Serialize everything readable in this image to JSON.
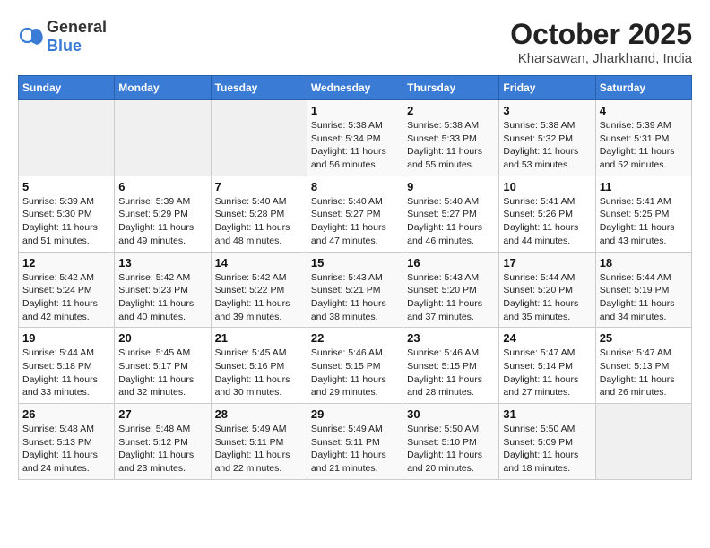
{
  "header": {
    "logo_general": "General",
    "logo_blue": "Blue",
    "month_year": "October 2025",
    "location": "Kharsawan, Jharkhand, India"
  },
  "days_of_week": [
    "Sunday",
    "Monday",
    "Tuesday",
    "Wednesday",
    "Thursday",
    "Friday",
    "Saturday"
  ],
  "weeks": [
    [
      {
        "day": "",
        "sunrise": "",
        "sunset": "",
        "daylight": "",
        "empty": true
      },
      {
        "day": "",
        "sunrise": "",
        "sunset": "",
        "daylight": "",
        "empty": true
      },
      {
        "day": "",
        "sunrise": "",
        "sunset": "",
        "daylight": "",
        "empty": true
      },
      {
        "day": "1",
        "sunrise": "Sunrise: 5:38 AM",
        "sunset": "Sunset: 5:34 PM",
        "daylight": "Daylight: 11 hours and 56 minutes."
      },
      {
        "day": "2",
        "sunrise": "Sunrise: 5:38 AM",
        "sunset": "Sunset: 5:33 PM",
        "daylight": "Daylight: 11 hours and 55 minutes."
      },
      {
        "day": "3",
        "sunrise": "Sunrise: 5:38 AM",
        "sunset": "Sunset: 5:32 PM",
        "daylight": "Daylight: 11 hours and 53 minutes."
      },
      {
        "day": "4",
        "sunrise": "Sunrise: 5:39 AM",
        "sunset": "Sunset: 5:31 PM",
        "daylight": "Daylight: 11 hours and 52 minutes."
      }
    ],
    [
      {
        "day": "5",
        "sunrise": "Sunrise: 5:39 AM",
        "sunset": "Sunset: 5:30 PM",
        "daylight": "Daylight: 11 hours and 51 minutes."
      },
      {
        "day": "6",
        "sunrise": "Sunrise: 5:39 AM",
        "sunset": "Sunset: 5:29 PM",
        "daylight": "Daylight: 11 hours and 49 minutes."
      },
      {
        "day": "7",
        "sunrise": "Sunrise: 5:40 AM",
        "sunset": "Sunset: 5:28 PM",
        "daylight": "Daylight: 11 hours and 48 minutes."
      },
      {
        "day": "8",
        "sunrise": "Sunrise: 5:40 AM",
        "sunset": "Sunset: 5:27 PM",
        "daylight": "Daylight: 11 hours and 47 minutes."
      },
      {
        "day": "9",
        "sunrise": "Sunrise: 5:40 AM",
        "sunset": "Sunset: 5:27 PM",
        "daylight": "Daylight: 11 hours and 46 minutes."
      },
      {
        "day": "10",
        "sunrise": "Sunrise: 5:41 AM",
        "sunset": "Sunset: 5:26 PM",
        "daylight": "Daylight: 11 hours and 44 minutes."
      },
      {
        "day": "11",
        "sunrise": "Sunrise: 5:41 AM",
        "sunset": "Sunset: 5:25 PM",
        "daylight": "Daylight: 11 hours and 43 minutes."
      }
    ],
    [
      {
        "day": "12",
        "sunrise": "Sunrise: 5:42 AM",
        "sunset": "Sunset: 5:24 PM",
        "daylight": "Daylight: 11 hours and 42 minutes."
      },
      {
        "day": "13",
        "sunrise": "Sunrise: 5:42 AM",
        "sunset": "Sunset: 5:23 PM",
        "daylight": "Daylight: 11 hours and 40 minutes."
      },
      {
        "day": "14",
        "sunrise": "Sunrise: 5:42 AM",
        "sunset": "Sunset: 5:22 PM",
        "daylight": "Daylight: 11 hours and 39 minutes."
      },
      {
        "day": "15",
        "sunrise": "Sunrise: 5:43 AM",
        "sunset": "Sunset: 5:21 PM",
        "daylight": "Daylight: 11 hours and 38 minutes."
      },
      {
        "day": "16",
        "sunrise": "Sunrise: 5:43 AM",
        "sunset": "Sunset: 5:20 PM",
        "daylight": "Daylight: 11 hours and 37 minutes."
      },
      {
        "day": "17",
        "sunrise": "Sunrise: 5:44 AM",
        "sunset": "Sunset: 5:20 PM",
        "daylight": "Daylight: 11 hours and 35 minutes."
      },
      {
        "day": "18",
        "sunrise": "Sunrise: 5:44 AM",
        "sunset": "Sunset: 5:19 PM",
        "daylight": "Daylight: 11 hours and 34 minutes."
      }
    ],
    [
      {
        "day": "19",
        "sunrise": "Sunrise: 5:44 AM",
        "sunset": "Sunset: 5:18 PM",
        "daylight": "Daylight: 11 hours and 33 minutes."
      },
      {
        "day": "20",
        "sunrise": "Sunrise: 5:45 AM",
        "sunset": "Sunset: 5:17 PM",
        "daylight": "Daylight: 11 hours and 32 minutes."
      },
      {
        "day": "21",
        "sunrise": "Sunrise: 5:45 AM",
        "sunset": "Sunset: 5:16 PM",
        "daylight": "Daylight: 11 hours and 30 minutes."
      },
      {
        "day": "22",
        "sunrise": "Sunrise: 5:46 AM",
        "sunset": "Sunset: 5:15 PM",
        "daylight": "Daylight: 11 hours and 29 minutes."
      },
      {
        "day": "23",
        "sunrise": "Sunrise: 5:46 AM",
        "sunset": "Sunset: 5:15 PM",
        "daylight": "Daylight: 11 hours and 28 minutes."
      },
      {
        "day": "24",
        "sunrise": "Sunrise: 5:47 AM",
        "sunset": "Sunset: 5:14 PM",
        "daylight": "Daylight: 11 hours and 27 minutes."
      },
      {
        "day": "25",
        "sunrise": "Sunrise: 5:47 AM",
        "sunset": "Sunset: 5:13 PM",
        "daylight": "Daylight: 11 hours and 26 minutes."
      }
    ],
    [
      {
        "day": "26",
        "sunrise": "Sunrise: 5:48 AM",
        "sunset": "Sunset: 5:13 PM",
        "daylight": "Daylight: 11 hours and 24 minutes."
      },
      {
        "day": "27",
        "sunrise": "Sunrise: 5:48 AM",
        "sunset": "Sunset: 5:12 PM",
        "daylight": "Daylight: 11 hours and 23 minutes."
      },
      {
        "day": "28",
        "sunrise": "Sunrise: 5:49 AM",
        "sunset": "Sunset: 5:11 PM",
        "daylight": "Daylight: 11 hours and 22 minutes."
      },
      {
        "day": "29",
        "sunrise": "Sunrise: 5:49 AM",
        "sunset": "Sunset: 5:11 PM",
        "daylight": "Daylight: 11 hours and 21 minutes."
      },
      {
        "day": "30",
        "sunrise": "Sunrise: 5:50 AM",
        "sunset": "Sunset: 5:10 PM",
        "daylight": "Daylight: 11 hours and 20 minutes."
      },
      {
        "day": "31",
        "sunrise": "Sunrise: 5:50 AM",
        "sunset": "Sunset: 5:09 PM",
        "daylight": "Daylight: 11 hours and 18 minutes."
      },
      {
        "day": "",
        "sunrise": "",
        "sunset": "",
        "daylight": "",
        "empty": true
      }
    ]
  ]
}
